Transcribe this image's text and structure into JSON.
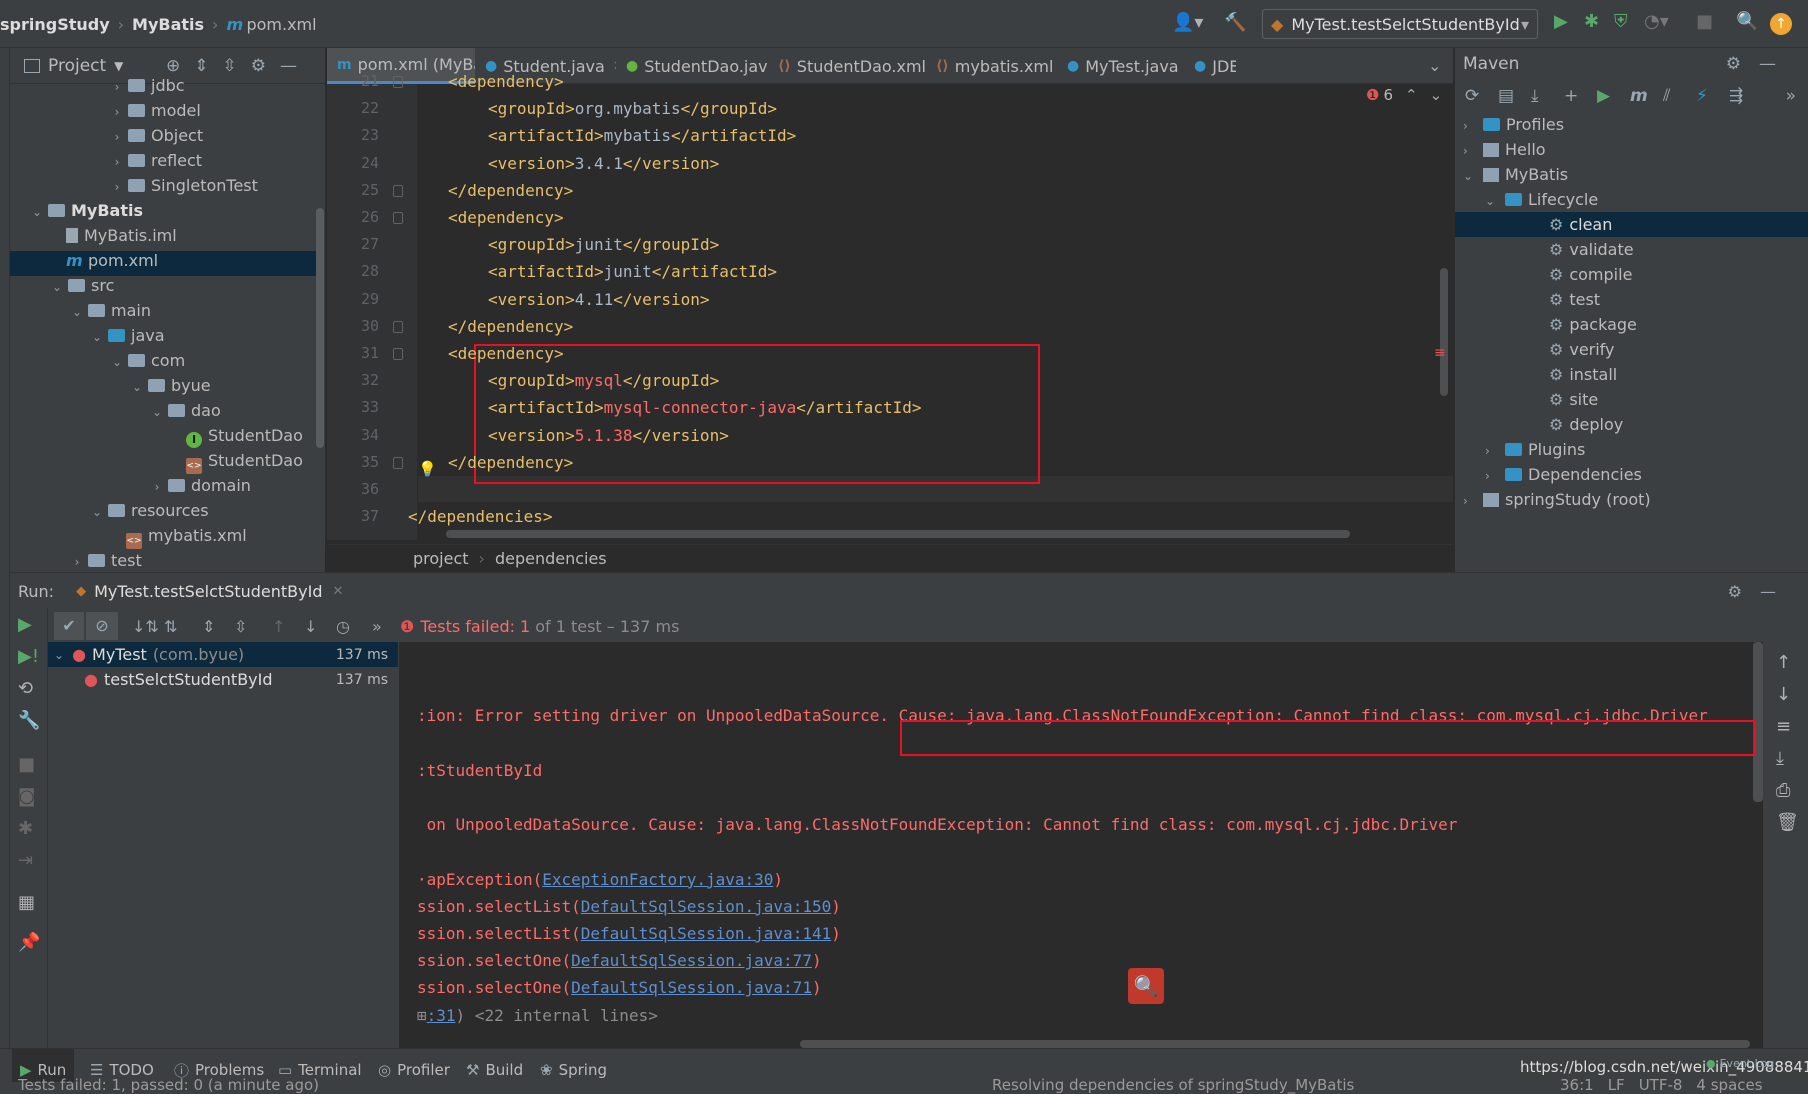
{
  "topbar": {
    "breadcrumb": [
      "springStudy",
      "MyBatis",
      "pom.xml"
    ],
    "run_config": "MyTest.testSelctStudentById"
  },
  "project_panel": {
    "title": "Project",
    "tree": [
      {
        "label": "jdbc",
        "kind": "folder",
        "depth": 5,
        "arrow": "›"
      },
      {
        "label": "model",
        "kind": "folder",
        "depth": 5,
        "arrow": "›"
      },
      {
        "label": "Object",
        "kind": "folder",
        "depth": 5,
        "arrow": "›"
      },
      {
        "label": "reflect",
        "kind": "folder",
        "depth": 5,
        "arrow": "›"
      },
      {
        "label": "SingletonTest",
        "kind": "folder",
        "depth": 5,
        "arrow": "›"
      },
      {
        "label": "MyBatis",
        "kind": "module",
        "depth": 1,
        "arrow": "⌄"
      },
      {
        "label": "MyBatis.iml",
        "kind": "iml",
        "depth": 2,
        "arrow": ""
      },
      {
        "label": "pom.xml",
        "kind": "maven",
        "depth": 2,
        "arrow": "",
        "selected": true
      },
      {
        "label": "src",
        "kind": "folder",
        "depth": 2,
        "arrow": "⌄"
      },
      {
        "label": "main",
        "kind": "folder",
        "depth": 3,
        "arrow": "⌄"
      },
      {
        "label": "java",
        "kind": "srcfolder",
        "depth": 4,
        "arrow": "⌄"
      },
      {
        "label": "com",
        "kind": "folder",
        "depth": 5,
        "arrow": "⌄"
      },
      {
        "label": "byue",
        "kind": "folder",
        "depth": 6,
        "arrow": "⌄"
      },
      {
        "label": "dao",
        "kind": "folder",
        "depth": 7,
        "arrow": "⌄"
      },
      {
        "label": "StudentDao",
        "kind": "interface",
        "depth": 8,
        "arrow": ""
      },
      {
        "label": "StudentDao",
        "kind": "xml",
        "depth": 8,
        "arrow": ""
      },
      {
        "label": "domain",
        "kind": "folder",
        "depth": 7,
        "arrow": "›"
      },
      {
        "label": "resources",
        "kind": "resfolder",
        "depth": 4,
        "arrow": "⌄"
      },
      {
        "label": "mybatis.xml",
        "kind": "xml",
        "depth": 5,
        "arrow": ""
      },
      {
        "label": "test",
        "kind": "folder",
        "depth": 3,
        "arrow": "›"
      }
    ]
  },
  "editor": {
    "tabs": [
      {
        "label": "pom.xml (MyBatis)",
        "icon": "m",
        "active": true
      },
      {
        "label": "Student.java",
        "icon": "c"
      },
      {
        "label": "StudentDao.java",
        "icon": "i"
      },
      {
        "label": "StudentDao.xml",
        "icon": "x"
      },
      {
        "label": "mybatis.xml",
        "icon": "x"
      },
      {
        "label": "MyTest.java",
        "icon": "c"
      },
      {
        "label": "JDE",
        "icon": "c"
      }
    ],
    "error_count": "6",
    "lines": [
      {
        "no": "21",
        "indent": 1,
        "parts": [
          [
            "tag",
            "<dependency>"
          ]
        ]
      },
      {
        "no": "22",
        "indent": 2,
        "parts": [
          [
            "tag",
            "<groupId>"
          ],
          [
            "txt",
            "org.mybatis"
          ],
          [
            "tag",
            "</groupId>"
          ]
        ]
      },
      {
        "no": "23",
        "indent": 2,
        "parts": [
          [
            "tag",
            "<artifactId>"
          ],
          [
            "txt",
            "mybatis"
          ],
          [
            "tag",
            "</artifactId>"
          ]
        ]
      },
      {
        "no": "24",
        "indent": 2,
        "parts": [
          [
            "tag",
            "<version>"
          ],
          [
            "txt",
            "3.4.1"
          ],
          [
            "tag",
            "</version>"
          ]
        ]
      },
      {
        "no": "25",
        "indent": 1,
        "parts": [
          [
            "tag",
            "</dependency>"
          ]
        ]
      },
      {
        "no": "26",
        "indent": 1,
        "parts": [
          [
            "tag",
            "<dependency>"
          ]
        ]
      },
      {
        "no": "27",
        "indent": 2,
        "parts": [
          [
            "tag",
            "<groupId>"
          ],
          [
            "txt",
            "junit"
          ],
          [
            "tag",
            "</groupId>"
          ]
        ]
      },
      {
        "no": "28",
        "indent": 2,
        "parts": [
          [
            "tag",
            "<artifactId>"
          ],
          [
            "txt",
            "junit"
          ],
          [
            "tag",
            "</artifactId>"
          ]
        ]
      },
      {
        "no": "29",
        "indent": 2,
        "parts": [
          [
            "tag",
            "<version>"
          ],
          [
            "txt",
            "4.11"
          ],
          [
            "tag",
            "</version>"
          ]
        ]
      },
      {
        "no": "30",
        "indent": 1,
        "parts": [
          [
            "tag",
            "</dependency>"
          ]
        ]
      },
      {
        "no": "31",
        "indent": 1,
        "parts": [
          [
            "tag",
            "<dependency>"
          ]
        ]
      },
      {
        "no": "32",
        "indent": 2,
        "parts": [
          [
            "tag",
            "<groupId>"
          ],
          [
            "red",
            "mysql"
          ],
          [
            "tag",
            "</groupId>"
          ]
        ]
      },
      {
        "no": "33",
        "indent": 2,
        "parts": [
          [
            "tag",
            "<artifactId>"
          ],
          [
            "red",
            "mysql-connector-java"
          ],
          [
            "tag",
            "</artifactId>"
          ]
        ]
      },
      {
        "no": "34",
        "indent": 2,
        "parts": [
          [
            "tag",
            "<version>"
          ],
          [
            "red",
            "5.1.38"
          ],
          [
            "tag",
            "</version>"
          ]
        ]
      },
      {
        "no": "35",
        "indent": 1,
        "parts": [
          [
            "tag",
            "</dependency>"
          ]
        ]
      },
      {
        "no": "36",
        "indent": 0,
        "parts": []
      },
      {
        "no": "37",
        "indent": 0,
        "parts": [
          [
            "tag",
            "</dependencies>"
          ]
        ]
      }
    ],
    "breadcrumb": [
      "project",
      "dependencies"
    ]
  },
  "maven": {
    "title": "Maven",
    "tree": [
      {
        "label": "Profiles",
        "depth": 0,
        "arrow": "›",
        "kind": "folder"
      },
      {
        "label": "Hello",
        "depth": 0,
        "arrow": "›",
        "kind": "module"
      },
      {
        "label": "MyBatis",
        "depth": 0,
        "arrow": "⌄",
        "kind": "module"
      },
      {
        "label": "Lifecycle",
        "depth": 1,
        "arrow": "⌄",
        "kind": "folder"
      },
      {
        "label": "clean",
        "depth": 2,
        "arrow": "",
        "kind": "goal",
        "selected": true
      },
      {
        "label": "validate",
        "depth": 2,
        "arrow": "",
        "kind": "goal"
      },
      {
        "label": "compile",
        "depth": 2,
        "arrow": "",
        "kind": "goal"
      },
      {
        "label": "test",
        "depth": 2,
        "arrow": "",
        "kind": "goal"
      },
      {
        "label": "package",
        "depth": 2,
        "arrow": "",
        "kind": "goal"
      },
      {
        "label": "verify",
        "depth": 2,
        "arrow": "",
        "kind": "goal"
      },
      {
        "label": "install",
        "depth": 2,
        "arrow": "",
        "kind": "goal"
      },
      {
        "label": "site",
        "depth": 2,
        "arrow": "",
        "kind": "goal"
      },
      {
        "label": "deploy",
        "depth": 2,
        "arrow": "",
        "kind": "goal"
      },
      {
        "label": "Plugins",
        "depth": 1,
        "arrow": "›",
        "kind": "folder"
      },
      {
        "label": "Dependencies",
        "depth": 1,
        "arrow": "›",
        "kind": "folder"
      },
      {
        "label": "springStudy (root)",
        "depth": 0,
        "arrow": "›",
        "kind": "module"
      }
    ]
  },
  "run": {
    "label": "Run:",
    "tab": "MyTest.testSelctStudentById",
    "status_prefix": "Tests failed:",
    "status_count": "1",
    "status_suffix": "of 1 test – 137 ms",
    "tests": [
      {
        "name": "MyTest",
        "pkg": "(com.byue)",
        "time": "137 ms"
      },
      {
        "name": "testSelctStudentById",
        "pkg": "",
        "time": "137 ms"
      }
    ],
    "console": [
      {
        "text": "",
        "type": "err"
      },
      {
        "text": "",
        "type": "err"
      },
      {
        "text": ":ion: Error setting driver on UnpooledDataSource.",
        "type": "err",
        "boxed": " Cause: java.lang.ClassNotFoundException: Cannot find class: com.mysql.cj.jdbc.Driver"
      },
      {
        "text": "",
        "type": "err"
      },
      {
        "text": ":tStudentById",
        "type": "err"
      },
      {
        "text": "",
        "type": "err"
      },
      {
        "text": " on UnpooledDataSource. Cause: java.lang.ClassNotFoundException: Cannot find class: com.mysql.cj.jdbc.Driver",
        "type": "err"
      },
      {
        "text": "",
        "type": "err"
      },
      {
        "text": "·apException(",
        "type": "err",
        "link": "ExceptionFactory.java:30",
        "tail": ")"
      },
      {
        "text": "ssion.selectList(",
        "type": "err",
        "link": "DefaultSqlSession.java:150",
        "tail": ")"
      },
      {
        "text": "ssion.selectList(",
        "type": "err",
        "link": "DefaultSqlSession.java:141",
        "tail": ")"
      },
      {
        "text": "ssion.selectOne(",
        "type": "err",
        "link": "DefaultSqlSession.java:77",
        "tail": ")"
      },
      {
        "text": "ssion.selectOne(",
        "type": "err",
        "link": "DefaultSqlSession.java:71",
        "tail": ")"
      },
      {
        "text": "",
        "type": "err",
        "link": ":31",
        "tail": ") <22 internal lines>",
        "prefix": "⊞"
      }
    ]
  },
  "bottom_tabs": [
    "Run",
    "TODO",
    "Problems",
    "Terminal",
    "Profiler",
    "Build",
    "Spring"
  ],
  "statusbar": {
    "left": "Tests failed: 1, passed: 0 (a minute ago)",
    "middle": "Resolving dependencies of springStudy_MyBatis",
    "position": "36:1",
    "lf": "LF",
    "encoding": "UTF-8",
    "indent": "4 spaces",
    "event_log": "Event Log"
  },
  "watermark": "https://blog.csdn.net/weixin_49088841",
  "colors": {
    "accent": "#4a88c7",
    "error": "#ff6b68",
    "highlight_box": "#e81123"
  }
}
